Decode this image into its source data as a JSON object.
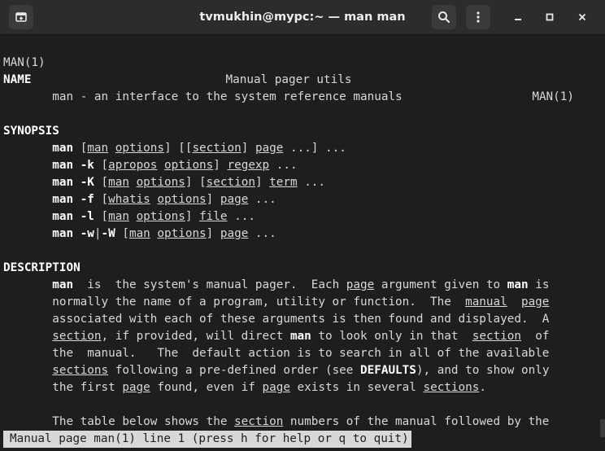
{
  "window": {
    "title": "tvmukhin@mypc:~ — man man"
  },
  "icons": {
    "new_tab": "new-tab-icon",
    "search": "search-icon",
    "menu": "kebab-menu-icon",
    "minimize": "minimize-icon",
    "maximize": "maximize-icon",
    "close": "close-icon"
  },
  "colors": {
    "terminal_bg": "#1e1e1e",
    "terminal_fg": "#d8d8d8",
    "titlebar_bg": "#2c2c2c"
  },
  "header": {
    "left": "MAN(1)",
    "center": "Manual pager utils",
    "right": "MAN(1)"
  },
  "sections": {
    "name": {
      "heading": "NAME",
      "text": "man - an interface to the system reference manuals"
    },
    "synopsis": {
      "heading": "SYNOPSIS"
    },
    "description": {
      "heading": "DESCRIPTION"
    }
  },
  "synopsis_words": {
    "man": "man",
    "k": "-k",
    "K": "-K",
    "f": "-f",
    "l": "-l",
    "w": "-w",
    "W": "-W",
    "options": "options",
    "section": "section",
    "page": "page",
    "apropos": "apropos",
    "regexp": "regexp",
    "term": "term",
    "whatis": "whatis",
    "file": "file"
  },
  "description_words": {
    "page": "page",
    "manual": "manual",
    "section": "section",
    "sections": "sections",
    "defaults": "DEFAULTS"
  },
  "status_bar": {
    "text": "Manual page man(1) line 1 (press h for help or q to quit)"
  }
}
